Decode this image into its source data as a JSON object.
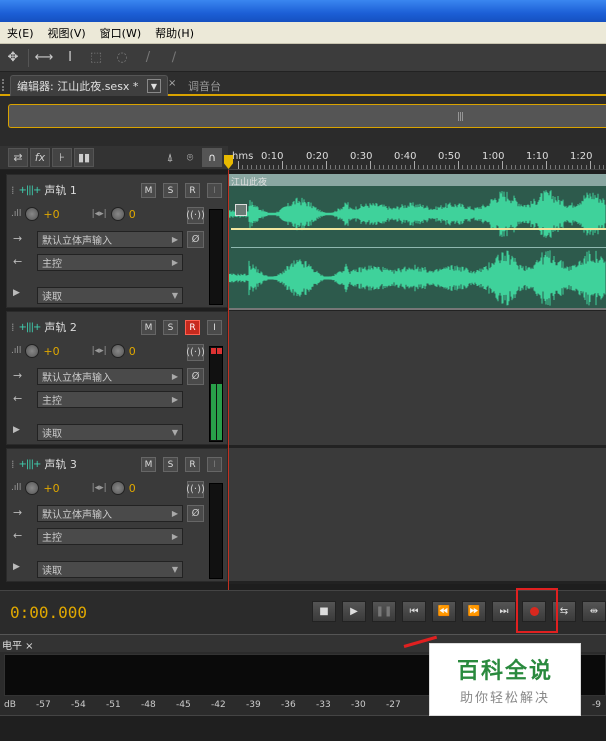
{
  "menu": [
    "夹(E)",
    "视图(V)",
    "窗口(W)",
    "帮助(H)"
  ],
  "editor_tab": {
    "label": "编辑器: 江山此夜.sesx *",
    "mixer_label": "调音台"
  },
  "ruler": {
    "unit": "hms",
    "ticks": [
      "0:10",
      "0:20",
      "0:30",
      "0:40",
      "0:50",
      "1:00",
      "1:10",
      "1:20"
    ]
  },
  "tracks": [
    {
      "name": "声轨 1",
      "volume": "+0",
      "pan": "0",
      "input": "默认立体声输入",
      "output": "主控",
      "mode": "读取",
      "record_armed": false,
      "meter_level": 0.0
    },
    {
      "name": "声轨 2",
      "volume": "+0",
      "pan": "0",
      "input": "默认立体声输入",
      "output": "主控",
      "mode": "读取",
      "record_armed": true,
      "meter_level": 0.7
    },
    {
      "name": "声轨 3",
      "volume": "+0",
      "pan": "0",
      "input": "默认立体声输入",
      "output": "主控",
      "mode": "读取",
      "record_armed": false,
      "meter_level": 0.0
    }
  ],
  "track_buttons": {
    "mute": "M",
    "solo": "S",
    "record": "R",
    "input": "I"
  },
  "clip": {
    "name": "江山此夜",
    "color": "#3fd29b"
  },
  "transport": {
    "timecode": "0:00.000"
  },
  "levels": {
    "tab": "电平",
    "scale": [
      "dB",
      "-57",
      "-54",
      "-51",
      "-48",
      "-45",
      "-42",
      "-39",
      "-36",
      "-33",
      "-30",
      "-27",
      "-9"
    ]
  },
  "watermark": {
    "main": "百科全说",
    "sub": "助你轻松解决"
  },
  "colors": {
    "accent": "#e0a800",
    "record": "#d8281e",
    "waveform": "#3fd29b",
    "annotation": "#e02020"
  }
}
